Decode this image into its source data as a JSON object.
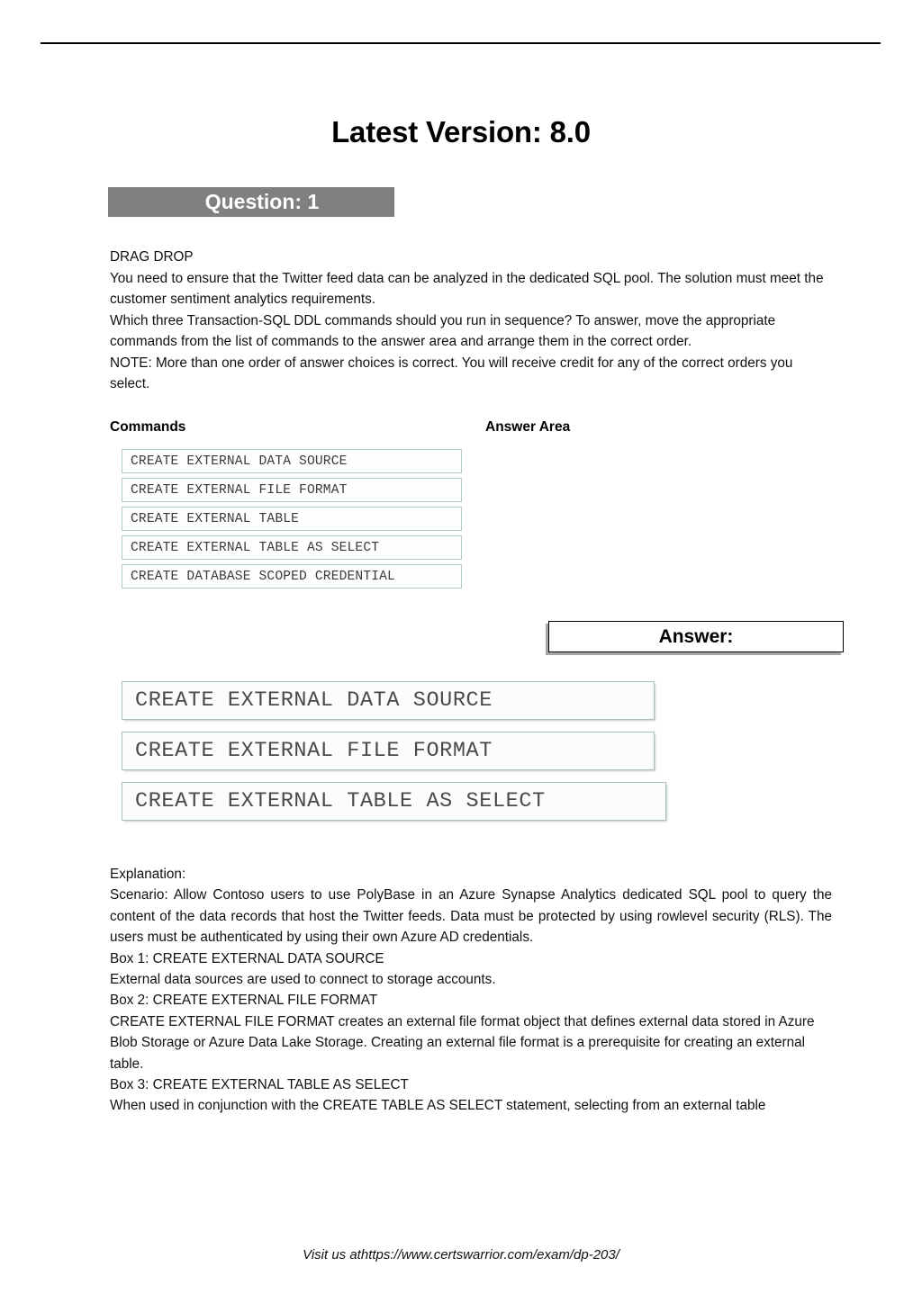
{
  "document": {
    "title": "Latest Version: 8.0",
    "question_banner": "Question: 1"
  },
  "question": {
    "type_label": "DRAG DROP",
    "line_1": "You need to ensure that the Twitter feed data can be analyzed in the dedicated SQL pool. The solution must meet the customer sentiment analytics requirements.",
    "line_2": "Which three Transaction-SQL DDL commands should you run in sequence? To answer, move the appropriate commands from the list of commands to the answer area and arrange them in the correct order.",
    "line_3": "NOTE: More than one order of answer choices is correct. You will receive credit for any of the correct orders you select."
  },
  "dragdrop": {
    "commands_label": "Commands",
    "answer_area_label": "Answer Area",
    "commands": [
      "CREATE EXTERNAL DATA SOURCE",
      "CREATE EXTERNAL FILE FORMAT",
      "CREATE EXTERNAL TABLE",
      "CREATE EXTERNAL TABLE AS SELECT",
      "CREATE DATABASE SCOPED CREDENTIAL"
    ]
  },
  "answer": {
    "label": "Answer:",
    "boxes": [
      "CREATE EXTERNAL DATA SOURCE",
      "CREATE EXTERNAL FILE FORMAT",
      "CREATE EXTERNAL TABLE AS SELECT"
    ]
  },
  "explanation": {
    "heading": "Explanation:",
    "scenario": "Scenario: Allow Contoso users to use PolyBase in an Azure Synapse Analytics dedicated SQL pool to query the content of the data records that host the Twitter feeds. Data must be protected by using rowlevel security (RLS). The users must be authenticated by using their own Azure AD credentials.",
    "box1_title": "Box 1: CREATE EXTERNAL DATA SOURCE",
    "box1_text": "External data sources are used to connect to storage accounts.",
    "box2_title": "Box 2: CREATE EXTERNAL FILE FORMAT",
    "box2_text": "CREATE EXTERNAL FILE FORMAT creates an external file format object that defines external data stored in Azure Blob Storage or Azure Data Lake Storage. Creating an external file format is a prerequisite for creating an external table.",
    "box3_title": "Box 3: CREATE EXTERNAL TABLE AS SELECT",
    "box3_text": "When used in conjunction with the CREATE TABLE AS SELECT statement, selecting from an external table"
  },
  "footer": {
    "text": "Visit us athttps://www.certswarrior.com/exam/dp-203/"
  },
  "colors": {
    "banner_bg": "#808080",
    "banner_text": "#ffffff",
    "command_border": "#b4ccd0",
    "answer_shot_border": "#a9bfc2",
    "answer_box_shadow": "#a6a6a6"
  }
}
